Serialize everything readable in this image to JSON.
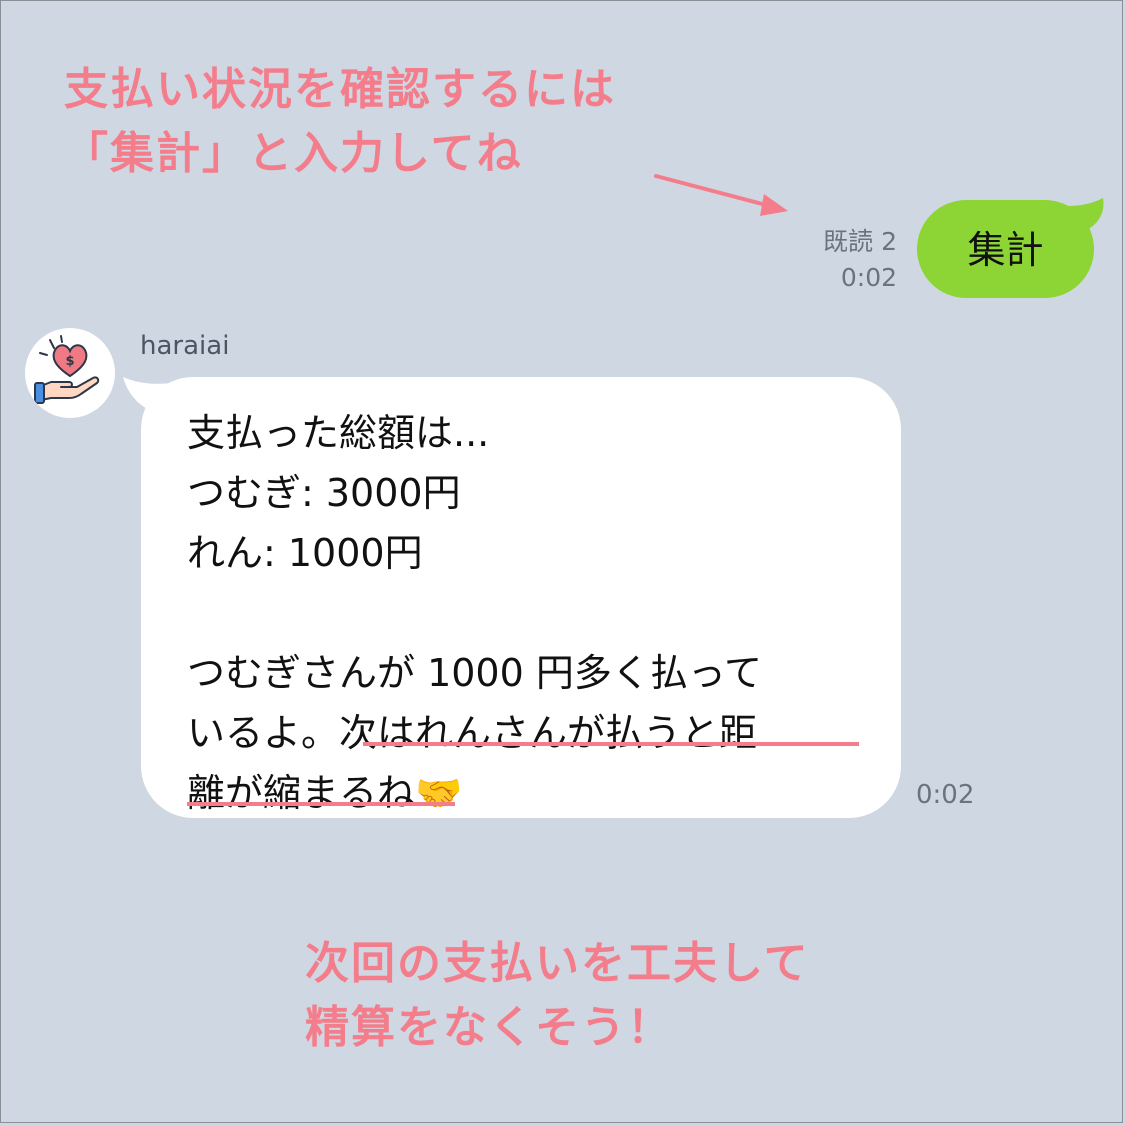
{
  "annotation_top": [
    "支払い状況を確認するには",
    "「集計」と入力してね"
  ],
  "annotation_bottom": [
    "次回の支払いを工夫して",
    "精算をなくそう！"
  ],
  "outgoing": {
    "read_status": "既読 2",
    "time": "0:02",
    "text": "集計",
    "bubble_color": "#8cd534"
  },
  "incoming": {
    "sender": "haraiai",
    "time": "0:02",
    "lines": [
      "支払った総額は...",
      "つむぎ: 3000円",
      "れん: 1000円",
      "",
      "つむぎさんが 1000 円多く払って",
      "いるよ。次はれんさんが払うと距",
      "離が縮まるね🤝"
    ]
  },
  "colors": {
    "background": "#cfd7e3",
    "annotation": "#f37d8b",
    "incoming_bubble": "#ffffff"
  },
  "icons": {
    "avatar": "heart-dollar-hand-icon",
    "arrow": "arrow-icon"
  }
}
